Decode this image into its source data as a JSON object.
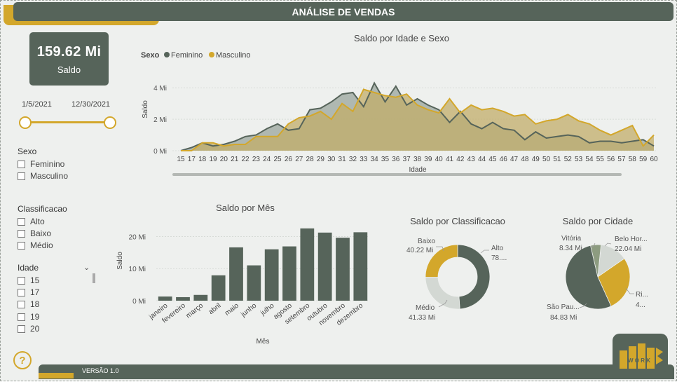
{
  "header": {
    "title": "ANÁLISE DE VENDAS"
  },
  "kpi": {
    "value": "159.62 Mi",
    "label": "Saldo"
  },
  "date_slider": {
    "start": "1/5/2021",
    "end": "12/30/2021"
  },
  "slicers": {
    "sexo": {
      "title": "Sexo",
      "options": [
        "Feminino",
        "Masculino"
      ]
    },
    "classificacao": {
      "title": "Classificacao",
      "options": [
        "Alto",
        "Baixo",
        "Médio"
      ]
    },
    "idade": {
      "title": "Idade",
      "options": [
        "15",
        "17",
        "18",
        "19",
        "20"
      ]
    }
  },
  "footer": {
    "version": "VERSÃO 1.0"
  },
  "logo": {
    "text": "W O R K"
  },
  "colors": {
    "dark": "#56645a",
    "gold": "#d3a72b",
    "light": "#d3d8d3",
    "sage": "#8d9c80",
    "background": "#eef0ee"
  },
  "chart_data": [
    {
      "id": "saldo-idade-sexo",
      "type": "area",
      "title": "Saldo por Idade e Sexo",
      "legend_title": "Sexo",
      "xlabel": "Idade",
      "ylabel": "Saldo",
      "y_ticks": [
        "0 Mi",
        "2 Mi",
        "4 Mi"
      ],
      "ylim": [
        0,
        4.5
      ],
      "x": [
        15,
        17,
        18,
        19,
        20,
        21,
        22,
        23,
        24,
        25,
        26,
        27,
        28,
        29,
        30,
        31,
        32,
        33,
        34,
        35,
        36,
        37,
        38,
        39,
        40,
        41,
        42,
        43,
        44,
        45,
        46,
        47,
        48,
        49,
        50,
        51,
        52,
        53,
        54,
        55,
        56,
        57,
        58,
        59,
        60
      ],
      "series": [
        {
          "name": "Feminino",
          "color": "#56645a",
          "values": [
            0.0,
            0.2,
            0.5,
            0.3,
            0.4,
            0.6,
            0.9,
            1.0,
            1.4,
            1.7,
            1.3,
            1.4,
            2.6,
            2.7,
            3.1,
            3.6,
            3.7,
            2.8,
            4.3,
            3.1,
            4.1,
            2.9,
            3.3,
            2.9,
            2.6,
            1.8,
            2.5,
            1.7,
            1.4,
            1.8,
            1.4,
            1.3,
            0.7,
            1.2,
            0.8,
            0.9,
            1.0,
            0.9,
            0.5,
            0.6,
            0.6,
            0.5,
            0.6,
            0.7,
            0.3
          ]
        },
        {
          "name": "Masculino",
          "color": "#d3a72b",
          "values": [
            0.0,
            0.0,
            0.5,
            0.5,
            0.3,
            0.4,
            0.4,
            0.9,
            0.9,
            0.9,
            1.7,
            2.1,
            2.2,
            2.5,
            2.0,
            3.0,
            2.5,
            3.9,
            3.7,
            3.5,
            3.4,
            3.6,
            2.9,
            2.6,
            2.4,
            3.3,
            2.4,
            2.9,
            2.6,
            2.7,
            2.5,
            2.2,
            2.3,
            1.7,
            1.9,
            2.0,
            2.3,
            1.9,
            1.7,
            1.3,
            1.0,
            1.3,
            1.6,
            0.3,
            1.0
          ]
        }
      ]
    },
    {
      "id": "saldo-por-mes",
      "type": "bar",
      "title": "Saldo por Mês",
      "xlabel": "Mês",
      "ylabel": "Saldo",
      "y_ticks": [
        "0 Mi",
        "10 Mi",
        "20 Mi"
      ],
      "ylim": [
        0,
        24
      ],
      "categories": [
        "janeiro",
        "fevereiro",
        "março",
        "abril",
        "maio",
        "junho",
        "julho",
        "agosto",
        "setembro",
        "outubro",
        "novembro",
        "dezembro"
      ],
      "values": [
        1.3,
        1.1,
        1.8,
        7.9,
        16.6,
        11.0,
        16.0,
        16.9,
        22.5,
        21.2,
        19.6,
        21.3
      ],
      "color": "#56645a"
    },
    {
      "id": "saldo-por-classificacao",
      "type": "pie",
      "donut": true,
      "title": "Saldo por Classificacao",
      "slices": [
        {
          "label": "Alto",
          "value_label": "78....",
          "value": 78.07,
          "color": "#56645a"
        },
        {
          "label": "Médio",
          "value_label": "41.33 Mi",
          "value": 41.33,
          "color": "#d3d8d3"
        },
        {
          "label": "Baixo",
          "value_label": "40.22 Mi",
          "value": 40.22,
          "color": "#d3a72b"
        }
      ]
    },
    {
      "id": "saldo-por-cidade",
      "type": "pie",
      "donut": false,
      "title": "Saldo por Cidade",
      "slices": [
        {
          "label": "Belo Hor...",
          "value_label": "22.04 Mi",
          "value": 22.04,
          "color": "#d3d8d3"
        },
        {
          "label": "Ri...",
          "value_label": "4...",
          "value": 44.4,
          "color": "#d3a72b"
        },
        {
          "label": "São Pau...",
          "value_label": "84.83 Mi",
          "value": 84.83,
          "color": "#56645a"
        },
        {
          "label": "Vitória",
          "value_label": "8.34 Mi",
          "value": 8.34,
          "color": "#8d9c80"
        }
      ]
    }
  ]
}
